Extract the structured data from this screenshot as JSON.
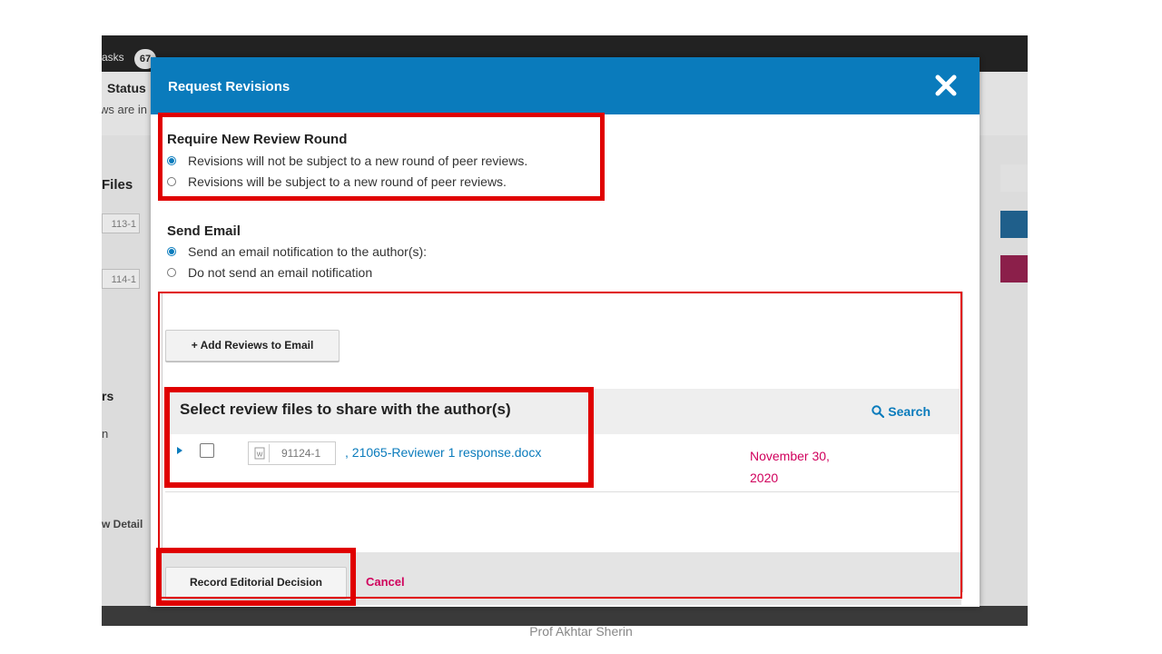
{
  "background": {
    "tasks_label": "asks",
    "tasks_count": "67",
    "status_label": "Status",
    "status_subtext": "ws are in",
    "files_label": "Files",
    "file_chips": [
      "113-1",
      "114-1"
    ],
    "reviewers_label": "rs",
    "reviewer_text": "n",
    "view_details": "w Detail"
  },
  "modal": {
    "title": "Request Revisions",
    "review_round": {
      "heading": "Require New Review Round",
      "options": [
        {
          "label": "Revisions will not be subject to a new round of peer reviews.",
          "checked": true
        },
        {
          "label": "Revisions will be subject to a new round of peer reviews.",
          "checked": false
        }
      ]
    },
    "send_email": {
      "heading": "Send Email",
      "options": [
        {
          "label": "Send an email notification to the author(s):",
          "checked": true
        },
        {
          "label": "Do not send an email notification",
          "checked": false
        }
      ]
    },
    "add_reviews_label": "+ Add Reviews to Email",
    "files_section": {
      "title": "Select review files to share with the author(s)",
      "search_label": "Search",
      "files": [
        {
          "id": "91124-1",
          "name": ", 21065-Reviewer 1 response.docx",
          "date": "November 30, 2020"
        }
      ]
    },
    "record_button": "Record Editorial Decision",
    "cancel_label": "Cancel"
  },
  "watermark": "Prof Akhtar Sherin",
  "colors": {
    "header": "#0a7bbc",
    "accent": "#0a7bbc",
    "cancel": "#d0005c",
    "highlight": "#e00000"
  }
}
